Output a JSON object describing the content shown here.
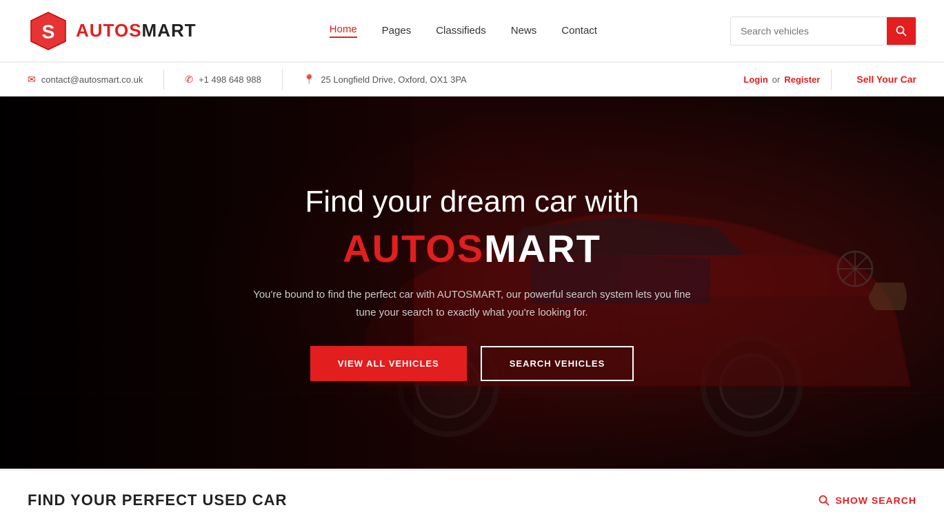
{
  "brand": {
    "name_part1": "AUTOS",
    "name_part2": "MART",
    "tagline": "AUTOSMART"
  },
  "nav": {
    "items": [
      {
        "label": "Home",
        "active": true
      },
      {
        "label": "Pages",
        "active": false
      },
      {
        "label": "Classifieds",
        "active": false
      },
      {
        "label": "News",
        "active": false
      },
      {
        "label": "Contact",
        "active": false
      }
    ]
  },
  "search": {
    "placeholder": "Search vehicles"
  },
  "infobar": {
    "email": "contact@autosmart.co.uk",
    "phone": "+1 498 648 988",
    "address": "25 Longfield Drive, Oxford, OX1 3PA",
    "login_label": "Login",
    "or_label": "or",
    "register_label": "Register",
    "sell_car_label": "Sell Your Car"
  },
  "hero": {
    "title_part1": "Find your dream car with",
    "brand_red": "AUTOS",
    "brand_white": "MART",
    "description": "You're bound to find the perfect car with AUTOSMART, our powerful search system lets you fine tune your search to exactly what you're looking for.",
    "btn_view": "VIEW ALL VEHICLES",
    "btn_search": "SEARCH VEHICLES"
  },
  "find_section": {
    "title": "FIND YOUR PERFECT USED CAR",
    "show_search_label": "SHOW SEARCH"
  }
}
